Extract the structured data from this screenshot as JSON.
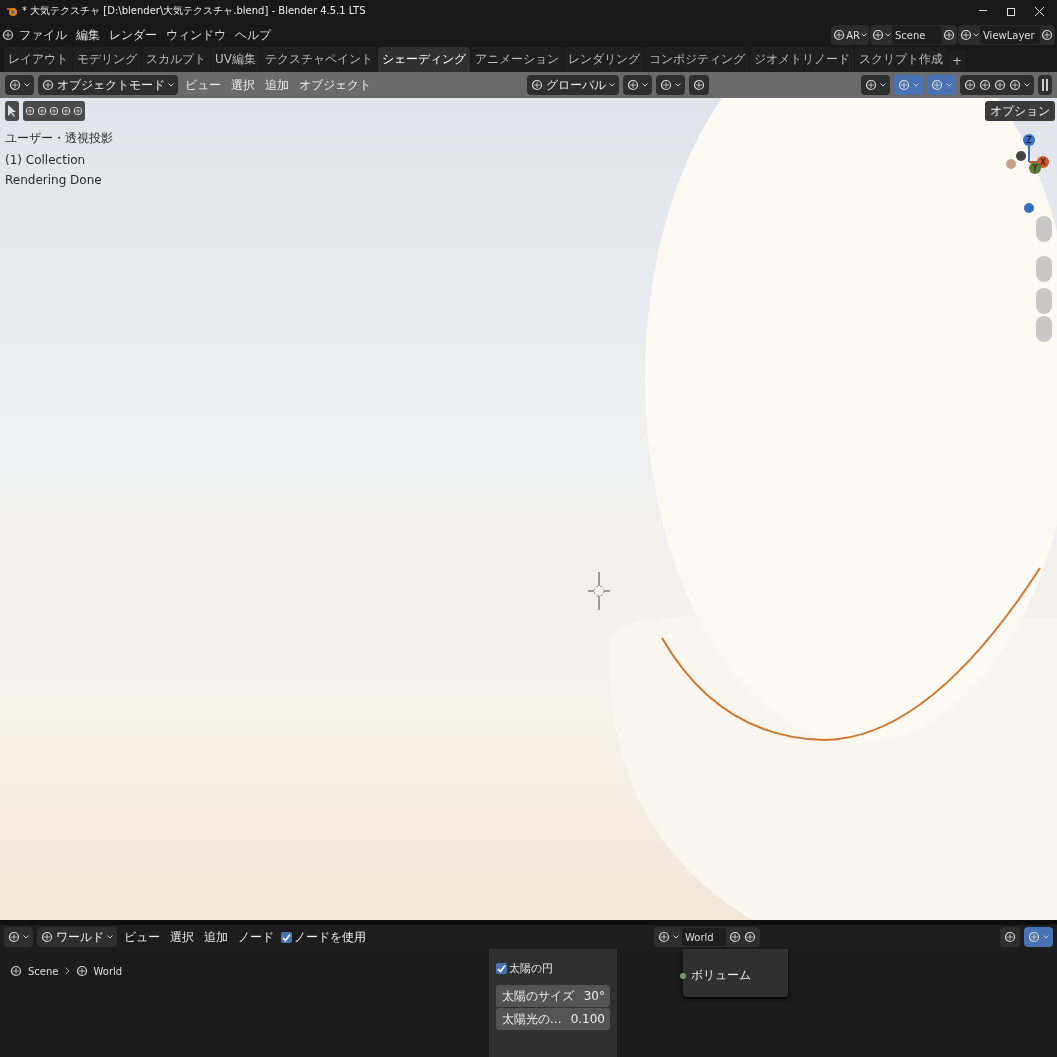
{
  "window": {
    "title": "* 大気テクスチャ [D:\\blender\\大気テクスチャ.blend] - Blender 4.5.1 LTS"
  },
  "menu": [
    "ファイル",
    "編集",
    "レンダー",
    "ウィンドウ",
    "ヘルプ"
  ],
  "workspaces": [
    {
      "label": "レイアウト",
      "selected": false
    },
    {
      "label": "モデリング",
      "selected": false
    },
    {
      "label": "スカルプト",
      "selected": false
    },
    {
      "label": "UV編集",
      "selected": false
    },
    {
      "label": "テクスチャペイント",
      "selected": false
    },
    {
      "label": "シェーディング",
      "selected": true
    },
    {
      "label": "アニメーション",
      "selected": false
    },
    {
      "label": "レンダリング",
      "selected": false
    },
    {
      "label": "コンポジティング",
      "selected": false
    },
    {
      "label": "ジオメトリノード",
      "selected": false
    },
    {
      "label": "スクリプト作成",
      "selected": false
    },
    {
      "label": "+",
      "selected": false
    }
  ],
  "top_right": {
    "engine": "AR",
    "scene": "Scene",
    "view_layer": "ViewLayer"
  },
  "viewport_header": {
    "mode": "オブジェクトモード",
    "menus": [
      "ビュー",
      "選択",
      "追加",
      "オブジェクト"
    ],
    "orientation": "グローバル",
    "options": "オプション"
  },
  "viewport_overlay": [
    "ユーザー・透視投影",
    "(1) Collection",
    "Rendering Done"
  ],
  "gizmo": {
    "axes": [
      "Z",
      "X",
      "Y"
    ]
  },
  "node_header": {
    "editor": "ワールド",
    "menus": [
      "ビュー",
      "選択",
      "追加",
      "ノード"
    ],
    "use_nodes": {
      "label": "ノードを使用",
      "checked": true
    },
    "world": "World"
  },
  "breadcrumb": [
    "Scene",
    "World"
  ],
  "sky_panel": {
    "sun_disc": {
      "label": "太陽の円",
      "checked": true
    },
    "fields": [
      {
        "label": "太陽のサイズ",
        "value": "30°"
      },
      {
        "label": "太陽光の...",
        "value": "0.100"
      }
    ]
  },
  "output_node": {
    "sockets": [
      "ボリューム"
    ]
  }
}
